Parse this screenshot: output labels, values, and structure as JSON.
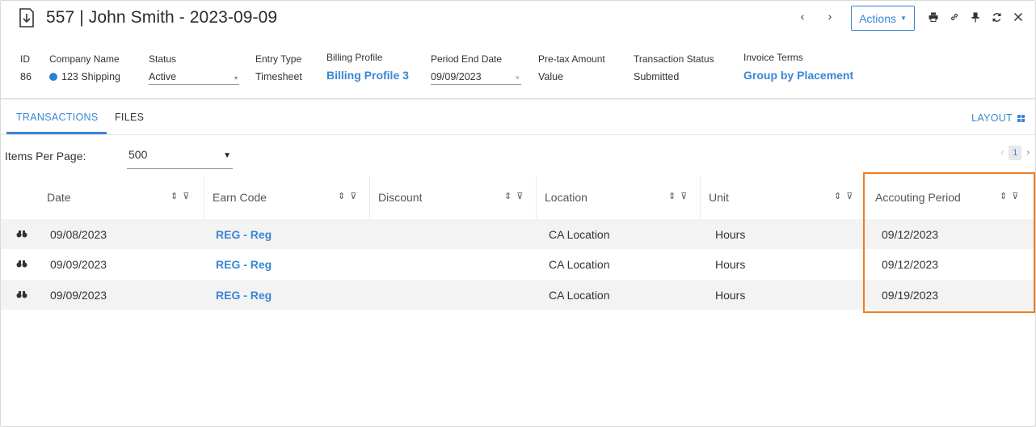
{
  "header": {
    "title": "557 | John Smith - 2023-09-09",
    "actions_label": "Actions"
  },
  "fields": [
    {
      "key": "id",
      "label": "ID",
      "value": "86"
    },
    {
      "key": "company",
      "label": "Company Name",
      "value": "123 Shipping"
    },
    {
      "key": "status",
      "label": "Status",
      "value": "Active"
    },
    {
      "key": "entry_type",
      "label": "Entry Type",
      "value": "Timesheet"
    },
    {
      "key": "billing_profile",
      "label": "Billing Profile",
      "value": "Billing Profile 3"
    },
    {
      "key": "period_end",
      "label": "Period End Date",
      "value": "09/09/2023"
    },
    {
      "key": "pretax",
      "label": "Pre-tax Amount",
      "value": "Value"
    },
    {
      "key": "txn_status",
      "label": "Transaction Status",
      "value": "Submitted"
    },
    {
      "key": "invoice_terms",
      "label": "Invoice Terms",
      "value": "Group by Placement"
    }
  ],
  "tabs": [
    {
      "label": "TRANSACTIONS",
      "active": true
    },
    {
      "label": "FILES",
      "active": false
    }
  ],
  "layout_label": "LAYOUT",
  "pager": {
    "items_per_page_label": "Items Per Page:",
    "items_per_page_value": "500",
    "current_page": "1"
  },
  "table": {
    "columns": [
      "Date",
      "Earn Code",
      "Discount",
      "Location",
      "Unit",
      "Accouting Period"
    ],
    "rows": [
      {
        "date": "09/08/2023",
        "earn_code": "REG - Reg",
        "discount": "",
        "location": "CA Location",
        "unit": "Hours",
        "accounting_period": "09/12/2023"
      },
      {
        "date": "09/09/2023",
        "earn_code": "REG - Reg",
        "discount": "",
        "location": "CA Location",
        "unit": "Hours",
        "accounting_period": "09/12/2023"
      },
      {
        "date": "09/09/2023",
        "earn_code": "REG - Reg",
        "discount": "",
        "location": "CA Location",
        "unit": "Hours",
        "accounting_period": "09/19/2023"
      }
    ]
  },
  "colors": {
    "accent": "#3a86d4",
    "highlight": "#ef7d1f",
    "row_shade": "#f3f3f3"
  }
}
